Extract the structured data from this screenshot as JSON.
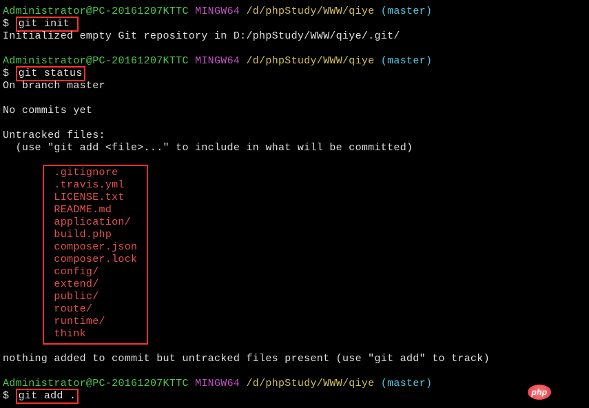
{
  "prompt1": {
    "user": "Administrator",
    "at": "@",
    "host": "PC-20161207KTTC",
    "mingw": " MINGW64",
    "path": " /d/phpStudy/WWW/qiye",
    "branch": " (master)",
    "dollar": "$ ",
    "cmd": "git init "
  },
  "init_output": "Initialized empty Git repository in D:/phpStudy/WWW/qiye/.git/",
  "prompt2": {
    "user": "Administrator",
    "at": "@",
    "host": "PC-20161207KTTC",
    "mingw": " MINGW64",
    "path": " /d/phpStudy/WWW/qiye",
    "branch": " (master)",
    "dollar": "$ ",
    "cmd": "git status"
  },
  "status": {
    "branch": "On branch master",
    "no_commits": "No commits yet",
    "untracked_header": "Untracked files:",
    "untracked_hint": "  (use \"git add <file>...\" to include in what will be committed)",
    "files": [
      "        .gitignore",
      "        .travis.yml",
      "        LICENSE.txt",
      "        README.md",
      "        application/",
      "        build.php",
      "        composer.json",
      "        composer.lock",
      "        config/",
      "        extend/",
      "        public/",
      "        route/",
      "        runtime/",
      "        think"
    ],
    "footer": "nothing added to commit but untracked files present (use \"git add\" to track)"
  },
  "prompt3": {
    "user": "Administrator",
    "at": "@",
    "host": "PC-20161207KTTC",
    "mingw": " MINGW64",
    "path": " /d/phpStudy/WWW/qiye",
    "branch": " (master)",
    "dollar": "$ ",
    "cmd": "git add ."
  },
  "badge": "php"
}
